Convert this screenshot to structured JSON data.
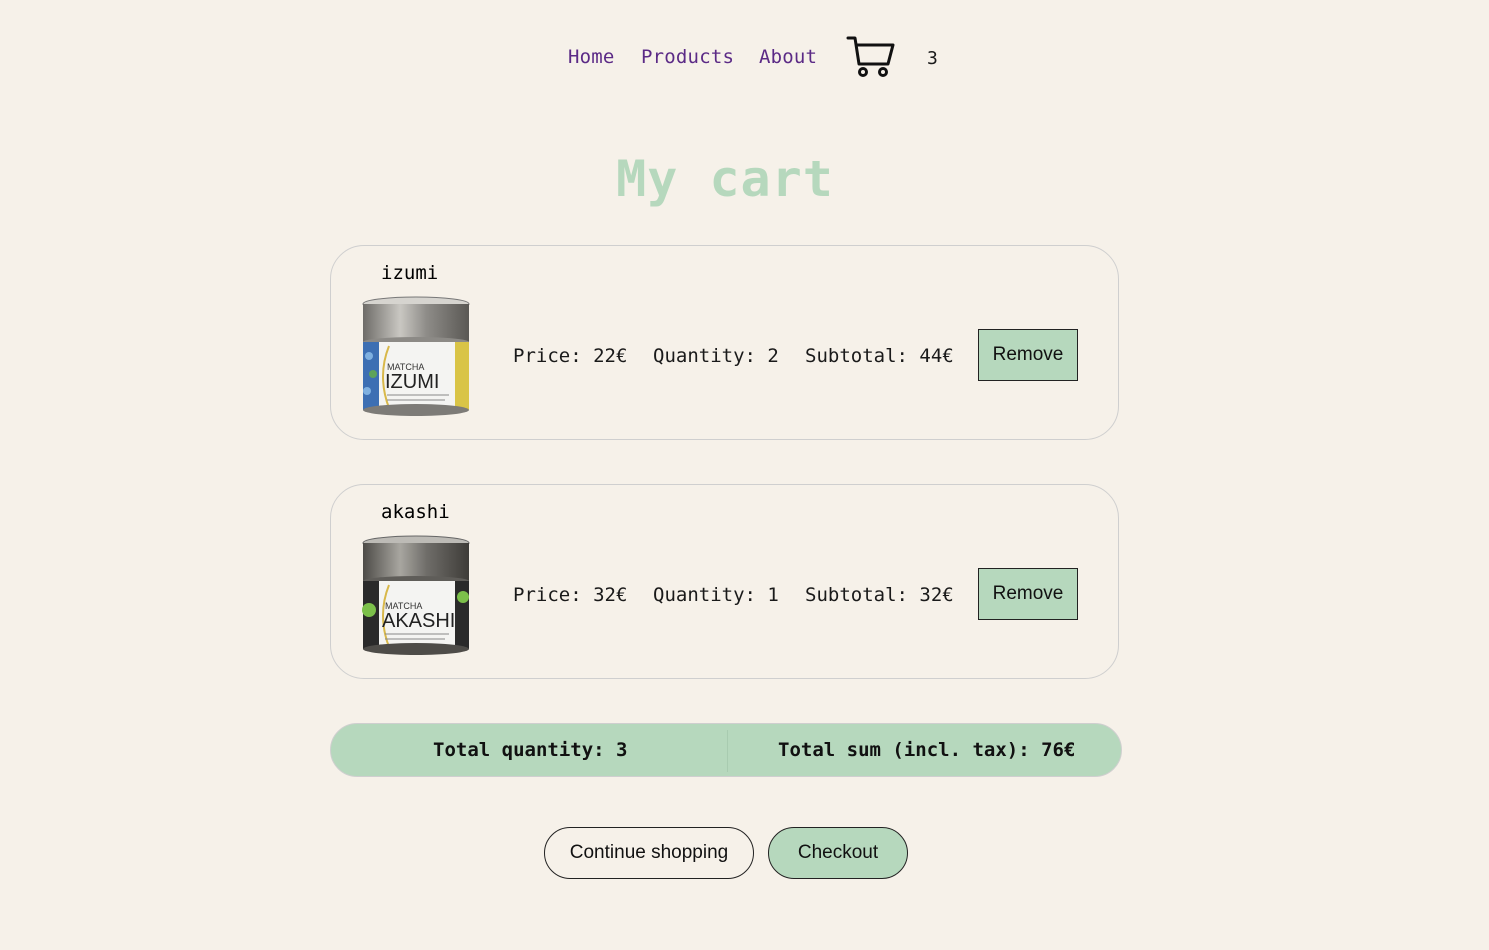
{
  "nav": {
    "home": "Home",
    "products": "Products",
    "about": "About",
    "cart_icon": "shopping-cart-icon",
    "cart_count": "3"
  },
  "page": {
    "title": "My cart"
  },
  "cart": {
    "items": [
      {
        "name": "izumi",
        "image_label_top": "MATCHA",
        "image_label_main": "IZUMI",
        "price": "Price: 22€",
        "quantity": "Quantity: 2",
        "subtotal": "Subtotal: 44€",
        "remove_label": "Remove"
      },
      {
        "name": "akashi",
        "image_label_top": "MATCHA",
        "image_label_main": "AKASHI",
        "price": "Price: 32€",
        "quantity": "Quantity: 1",
        "subtotal": "Subtotal: 32€",
        "remove_label": "Remove"
      }
    ]
  },
  "totals": {
    "quantity": "Total quantity: 3",
    "sum": "Total sum (incl. tax): 76€"
  },
  "actions": {
    "continue_label": "Continue shopping",
    "checkout_label": "Checkout"
  },
  "colors": {
    "background": "#f6f1e9",
    "accent": "#b6d8bd",
    "link": "#5b2a86"
  }
}
